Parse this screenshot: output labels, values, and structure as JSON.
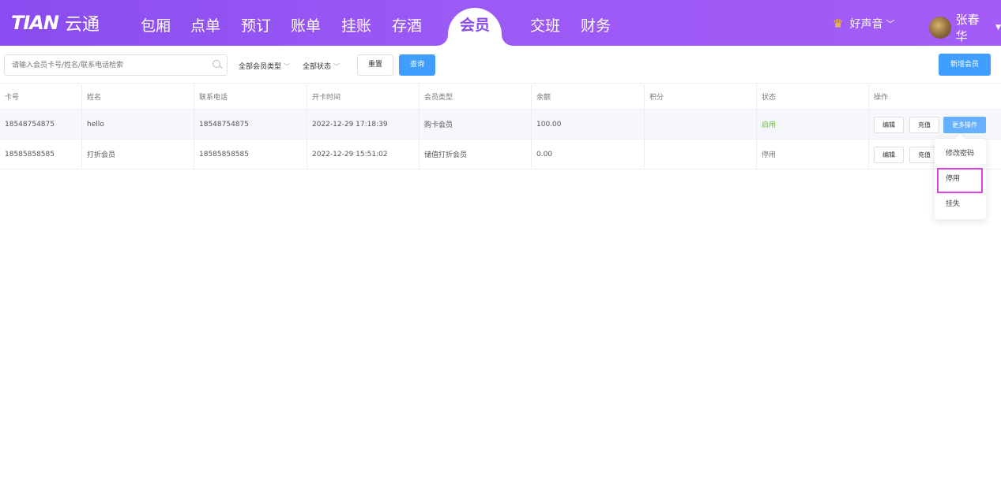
{
  "header": {
    "logo_mark": "TIAN",
    "logo_text": "云通",
    "nav": [
      {
        "label": "包厢"
      },
      {
        "label": "点单"
      },
      {
        "label": "预订"
      },
      {
        "label": "账单"
      },
      {
        "label": "挂账"
      },
      {
        "label": "存酒"
      },
      {
        "label": "会员"
      },
      {
        "label": "交班"
      },
      {
        "label": "财务"
      }
    ],
    "active_nav": "会员",
    "store_name": "好声音",
    "user_name": "张春华"
  },
  "toolbar": {
    "search_placeholder": "请输入会员卡号/姓名/联系电话检索",
    "member_type_filter": "全部会员类型",
    "status_filter": "全部状态",
    "reset_label": "重置",
    "query_label": "查询",
    "add_member_label": "新增会员"
  },
  "table": {
    "columns": [
      "卡号",
      "姓名",
      "联系电话",
      "开卡时间",
      "会员类型",
      "余额",
      "积分",
      "状态",
      "操作"
    ],
    "rows": [
      {
        "card_no": "18548754875",
        "name": "hello",
        "phone": "18548754875",
        "open_time": "2022-12-29 17:18:39",
        "type": "购卡会员",
        "balance": "100.00",
        "points": "",
        "status": "启用"
      },
      {
        "card_no": "18585858585",
        "name": "打折会员",
        "phone": "18585858585",
        "open_time": "2022-12-29 15:51:02",
        "type": "储值打折会员",
        "balance": "0.00",
        "points": "",
        "status": "停用"
      }
    ],
    "ops": {
      "edit": "编辑",
      "recharge": "充值",
      "more": "更多操作"
    }
  },
  "dropdown": {
    "items": [
      "修改密码",
      "停用",
      "挂失"
    ]
  },
  "colors": {
    "header_gradient_start": "#8a4cf0",
    "primary": "#409eff",
    "status_on": "#67c23a",
    "highlight": "#e040e8"
  }
}
